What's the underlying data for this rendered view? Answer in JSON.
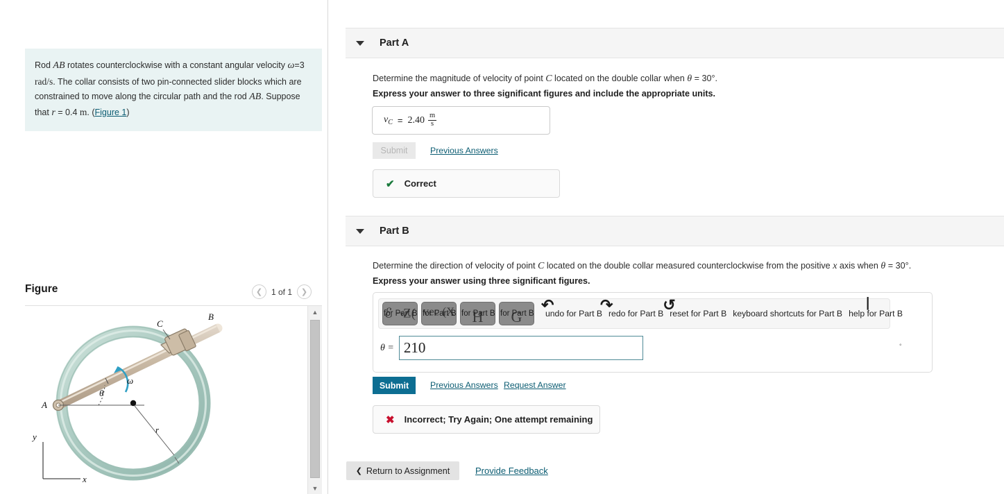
{
  "problem": {
    "line1_a": "Rod ",
    "line1_math": "AB",
    "line1_b": " rotates counterclockwise with a constant angular velocity",
    "omega_sym": "ω",
    "omega_eq": "=3",
    "omega_units": "rad/s",
    "line2_b": ". The collar consists of two pin-connected slider blocks which are constrained to move along the circular path and the rod ",
    "rod_name": "AB",
    "suppose": ". Suppose that ",
    "r_sym": "r",
    "r_val": " = 0.4 ",
    "r_units": "m",
    "period": ". (",
    "figure_link": "Figure 1",
    "close_paren": ")"
  },
  "figure": {
    "title": "Figure",
    "counter": "1 of 1",
    "prev_icon": "chevron-left-icon",
    "next_icon": "chevron-right-icon",
    "scroll_up_icon": "▲",
    "scroll_down_icon": "▼",
    "labels": {
      "A": "A",
      "B": "B",
      "C": "C",
      "omega": "ω",
      "theta": "θ",
      "r": "r",
      "x": "x",
      "y": "y"
    },
    "colors": {
      "ring": "#a9c9c0",
      "ring_light": "#cfe3dc",
      "rod": "#cfc0ac",
      "arrow": "#2f9fc4"
    }
  },
  "partA": {
    "caret_icon": "triangle-down-icon",
    "label": "Part A",
    "question_pre": "Determine the magnitude of velocity of point ",
    "question_c": "C",
    "question_mid": " located on the double collar when ",
    "question_theta": "θ",
    "question_post": " = 30°.",
    "instruction": "Express your answer to three significant figures and include the appropriate units.",
    "answer_var": "v",
    "answer_sub": "C",
    "answer_eq": "=",
    "answer_value": "2.40",
    "answer_unit_num": "m",
    "answer_unit_den": "s",
    "submit_label": "Submit",
    "previous_answers_label": "Previous Answers",
    "status_icon": "check-icon",
    "status_text": "Correct"
  },
  "partB": {
    "caret_icon": "triangle-down-icon",
    "label": "Part B",
    "question_pre": "Determine the direction of velocity of point ",
    "question_c": "C",
    "question_mid": " located on the double collar measured counterclockwise from the positive ",
    "question_x": "x",
    "question_mid2": " axis when ",
    "question_theta": "θ",
    "question_post": " = 30°.",
    "instruction": "Express your answer using three significant figures.",
    "toolbar": {
      "buttons": [
        {
          "glyph": "ℰ  ¬Z(",
          "alt": "for Part B",
          "name": "template-button"
        },
        {
          "glyph": "vec (X",
          "alt": "for Part B",
          "name": "vector-button"
        },
        {
          "glyph": "H",
          "alt": "for Part B",
          "name": "matrix-button"
        },
        {
          "glyph": "G",
          "alt": "for Part B",
          "name": "greek-button"
        }
      ],
      "texts": [
        {
          "label": "undo for Part B",
          "glyph": "↶",
          "name": "undo"
        },
        {
          "label": "redo for Part B",
          "glyph": "↷",
          "name": "redo"
        },
        {
          "label": "reset for Part B",
          "glyph": "↺",
          "name": "reset"
        },
        {
          "label": "keyboard shortcuts for Part B",
          "glyph": "",
          "name": "keyboard-shortcuts"
        },
        {
          "label": "help for Part B",
          "glyph": "❘",
          "name": "help"
        }
      ]
    },
    "input_label": "θ =",
    "input_value": "210",
    "input_placeholder": "",
    "degree_symbol": "°",
    "submit_label": "Submit",
    "previous_answers_label": "Previous Answers",
    "request_answer_label": "Request Answer",
    "status_icon": "cross-icon",
    "status_text": "Incorrect; Try Again; One attempt remaining"
  },
  "footer": {
    "return_icon": "chevron-left-icon",
    "return_label": "Return to Assignment",
    "feedback_label": "Provide Feedback"
  },
  "colors": {
    "accent": "#0d6e92",
    "link": "#0b5c72",
    "correct": "#1a7a3c",
    "incorrect": "#c8102e",
    "panel_bg": "#e9f3f3",
    "header_bg": "#f5f5f5"
  }
}
